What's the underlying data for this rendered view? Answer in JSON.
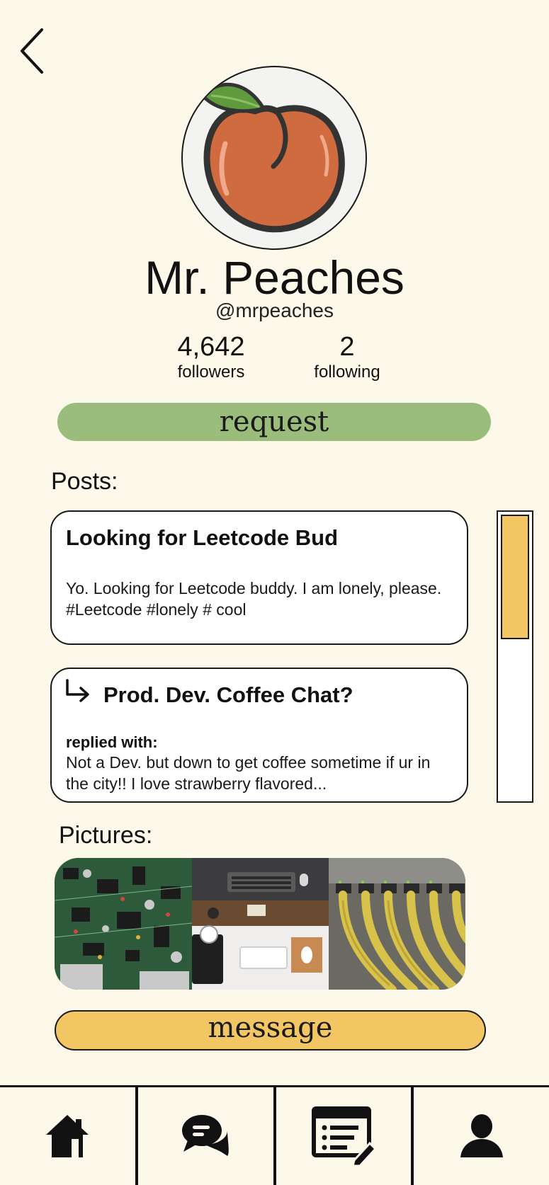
{
  "profile": {
    "name": "Mr. Peaches",
    "handle": "@mrpeaches",
    "followers_count": "4,642",
    "followers_label": "followers",
    "following_count": "2",
    "following_label": "following",
    "avatar_icon": "peach-icon"
  },
  "actions": {
    "request_label": "request",
    "message_label": "message"
  },
  "posts_section": {
    "title": "Posts:",
    "posts": [
      {
        "title": "Looking for Leetcode Bud",
        "body": "Yo. Looking for Leetcode buddy. I am lonely, please. #Leetcode #lonely # cool"
      },
      {
        "reply_icon": "reply-arrow-icon",
        "title": "Prod. Dev. Coffee Chat?",
        "replied_label": "replied with:",
        "body": "Not a Dev. but down to get coffee sometime if ur in the city!! I love strawberry flavored..."
      }
    ],
    "scroll_position": 0
  },
  "pictures_section": {
    "title": "Pictures:",
    "pictures": [
      "circuit-board-photo",
      "desk-workspace-photo",
      "ethernet-cables-photo"
    ]
  },
  "navbar": {
    "items": [
      "home-icon",
      "chat-icon",
      "posts-icon",
      "profile-icon"
    ]
  },
  "colors": {
    "background": "#fdf9ea",
    "request_button": "#9bbd7b",
    "message_button": "#f2c662",
    "scroll_thumb": "#f2c662",
    "peach": "#d06b3f"
  }
}
